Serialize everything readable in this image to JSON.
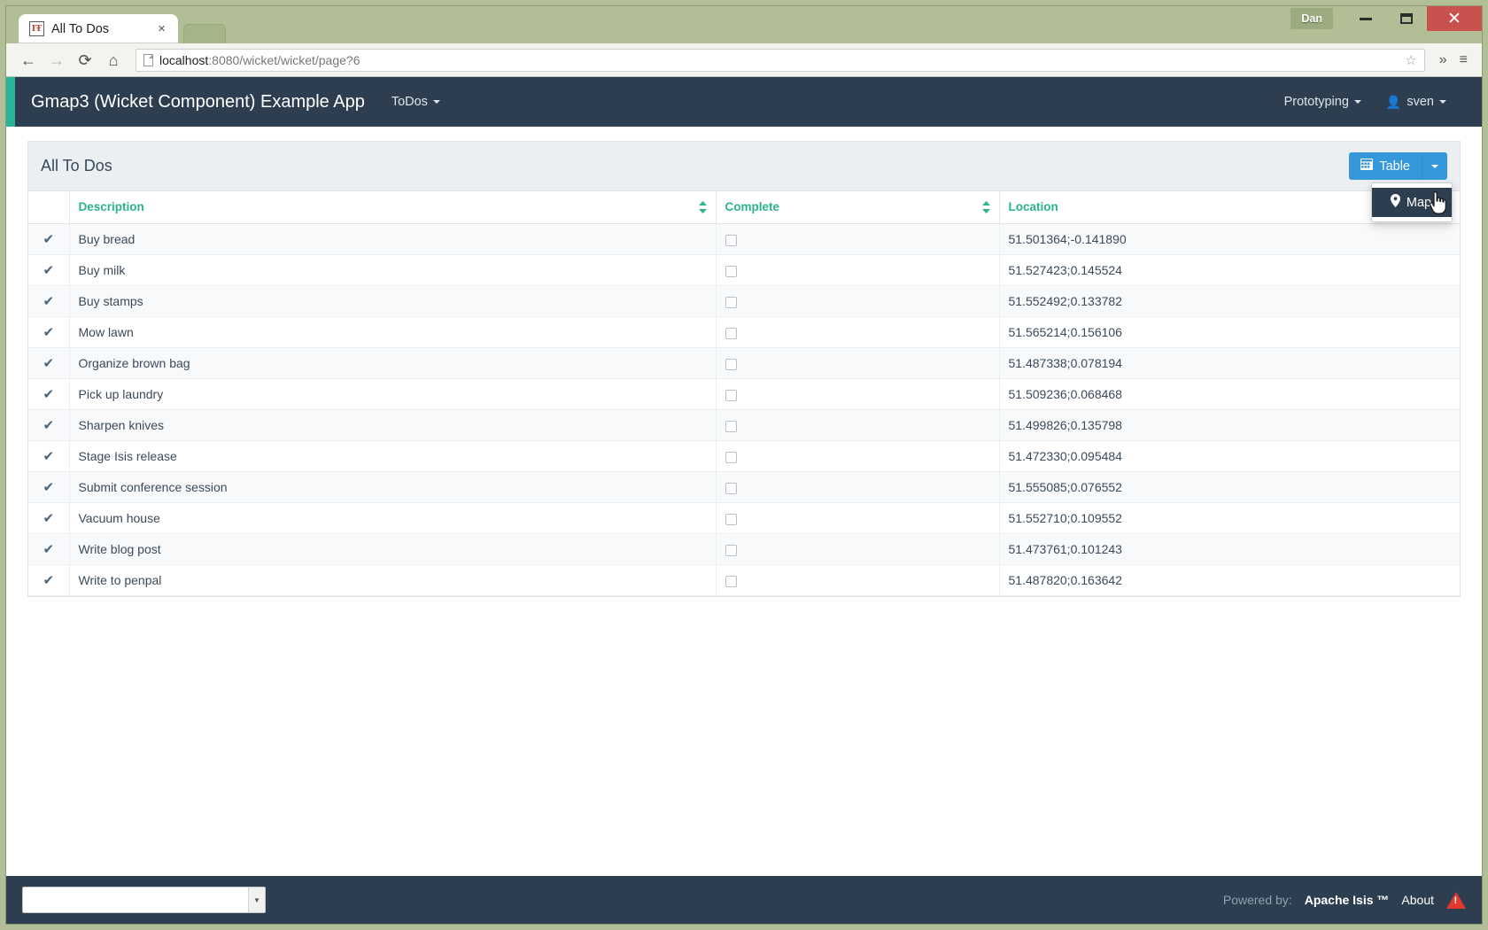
{
  "window": {
    "user_chip": "Dan",
    "minimize_label": "Minimize",
    "maximize_label": "Maximize",
    "close_label": "Close"
  },
  "browser": {
    "tab": {
      "title": "All To Dos",
      "favicon_glyph": "ⓘ",
      "close_glyph": "×"
    },
    "nav": {
      "back": "←",
      "forward": "→",
      "reload": "C",
      "home": "⌂"
    },
    "omnibox": {
      "url_host": "localhost",
      "url_rest": ":8080/wicket/wicket/page?6",
      "star_glyph": "☆"
    },
    "menu_glyph": "≡",
    "overflow_glyph": "»"
  },
  "appbar": {
    "brand": "Gmap3 (Wicket Component) Example App",
    "menus": [
      {
        "label": "ToDos",
        "has_caret": true
      }
    ],
    "right_menus": [
      {
        "label": "Prototyping",
        "has_caret": true
      },
      {
        "label": "sven",
        "has_caret": true,
        "icon": "person-icon"
      }
    ],
    "accent_color": "#28b498",
    "bg_color": "#2d3e50"
  },
  "page": {
    "title": "All To Dos",
    "view_button": {
      "label": "Table",
      "icon": "grid-icon"
    },
    "view_dropdown_open": true,
    "view_menu_items": [
      {
        "label": "Map",
        "icon": "map-pin-icon",
        "active": true
      }
    ]
  },
  "table": {
    "columns": [
      {
        "key": "check",
        "label": "",
        "sortable": false
      },
      {
        "key": "description",
        "label": "Description",
        "sortable": true
      },
      {
        "key": "complete",
        "label": "Complete",
        "sortable": true
      },
      {
        "key": "location",
        "label": "Location",
        "sortable": false
      }
    ],
    "rows": [
      {
        "description": "Buy bread",
        "complete": false,
        "location": "51.501364;-0.141890"
      },
      {
        "description": "Buy milk",
        "complete": false,
        "location": "51.527423;0.145524"
      },
      {
        "description": "Buy stamps",
        "complete": false,
        "location": "51.552492;0.133782"
      },
      {
        "description": "Mow lawn",
        "complete": false,
        "location": "51.565214;0.156106"
      },
      {
        "description": "Organize brown bag",
        "complete": false,
        "location": "51.487338;0.078194"
      },
      {
        "description": "Pick up laundry",
        "complete": false,
        "location": "51.509236;0.068468"
      },
      {
        "description": "Sharpen knives",
        "complete": false,
        "location": "51.499826;0.135798"
      },
      {
        "description": "Stage Isis release",
        "complete": false,
        "location": "51.472330;0.095484"
      },
      {
        "description": "Submit conference session",
        "complete": false,
        "location": "51.555085;0.076552"
      },
      {
        "description": "Vacuum house",
        "complete": false,
        "location": "51.552710;0.109552"
      },
      {
        "description": "Write blog post",
        "complete": false,
        "location": "51.473761;0.101243"
      },
      {
        "description": "Write to penpal",
        "complete": false,
        "location": "51.487820;0.163642"
      }
    ],
    "header_color": "#2ab38c"
  },
  "footer": {
    "select_value": "",
    "powered_by": "Powered by:",
    "product": "Apache Isis ™",
    "about": "About",
    "warning_icon": "warning-triangle-icon"
  }
}
